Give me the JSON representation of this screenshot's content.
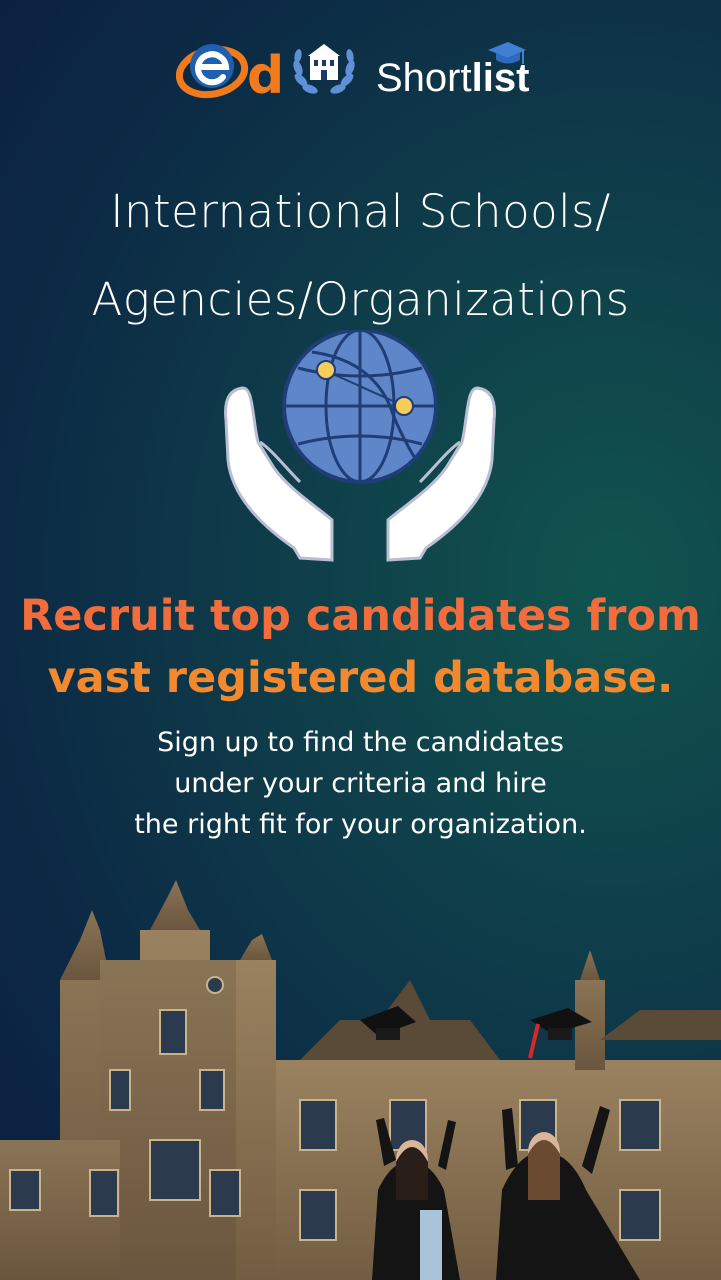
{
  "brand": {
    "logo_letter": "d",
    "name_regular": "Short",
    "name_bold": "list"
  },
  "headline": {
    "line1": "International Schools/",
    "line2": "Agencies/Organizations"
  },
  "tagline": {
    "line1": "Recruit top candidates from",
    "line2": "vast registered database."
  },
  "description": {
    "line1": "Sign up to find the candidates",
    "line2": "under your criteria and hire",
    "line3": "the right fit for your organization."
  },
  "colors": {
    "background": "#0c2a45",
    "accent_orange": "#f27531",
    "globe_blue": "#5f86c9",
    "text_white": "#ffffff"
  },
  "icons": [
    "edu-e-logo-icon",
    "school-laurel-badge-icon",
    "graduation-cap-icon",
    "globe-hands-icon"
  ]
}
